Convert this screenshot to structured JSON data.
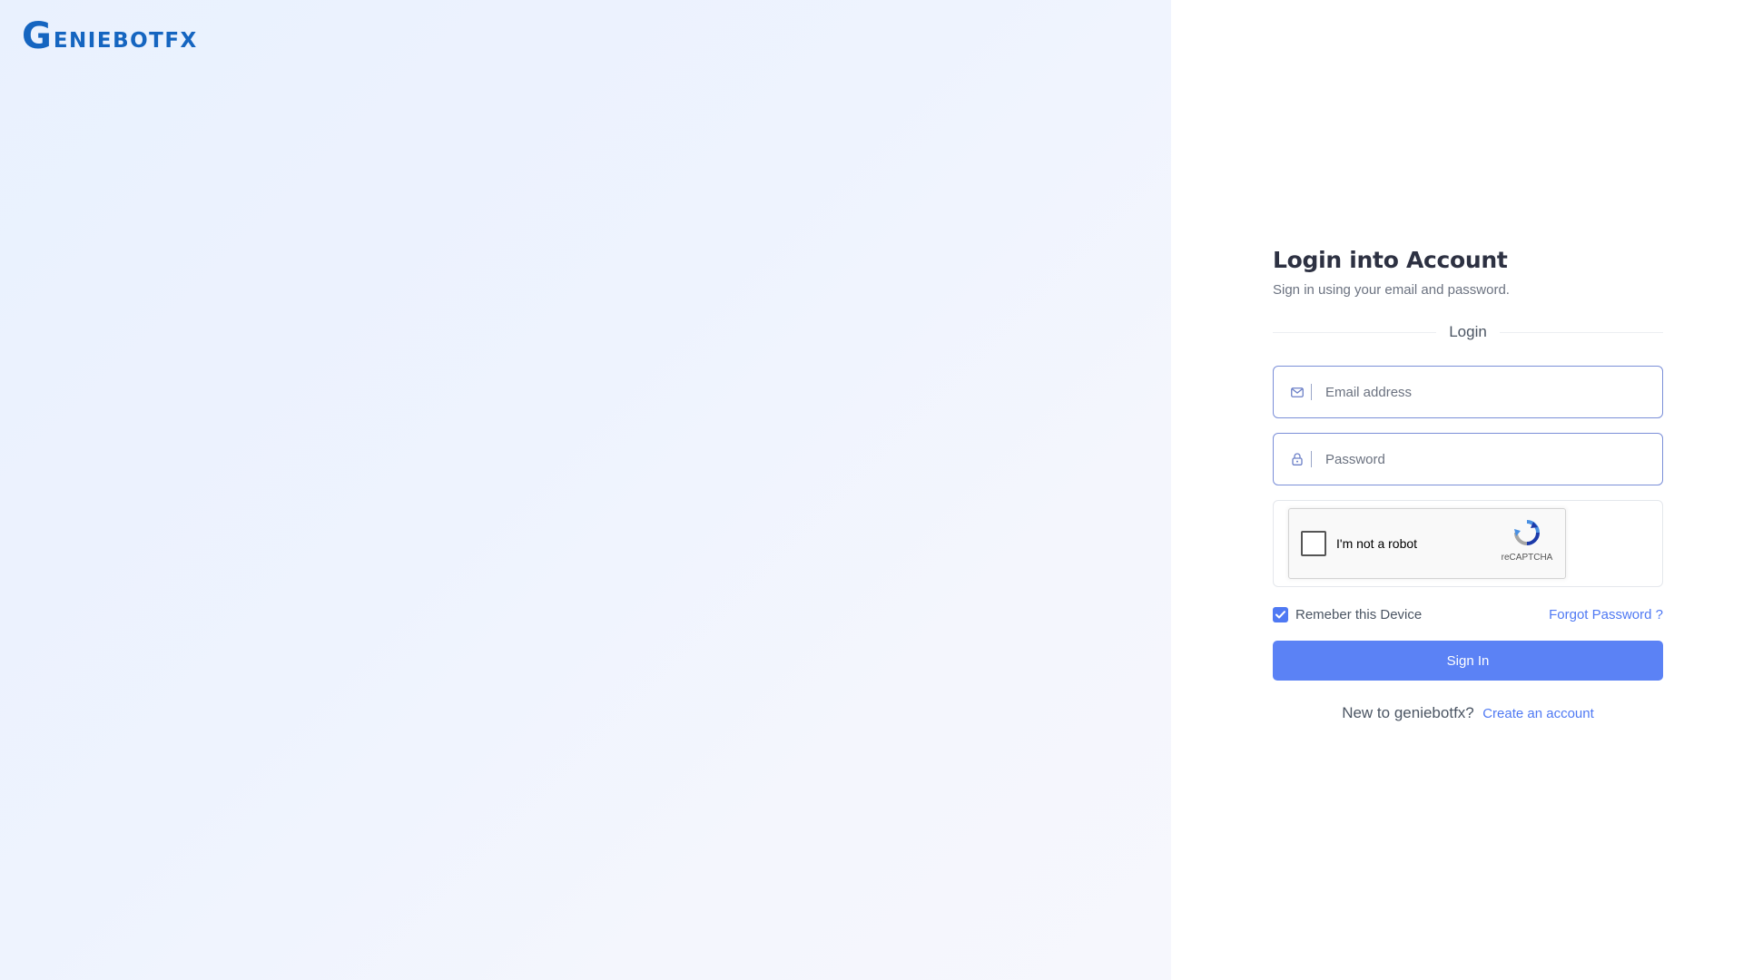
{
  "brand": {
    "logo_first": "G",
    "logo_rest": "ENIEBOTFX",
    "color": "#1565c0"
  },
  "form": {
    "title": "Login into Account",
    "subtitle": "Sign in using your email and password.",
    "divider_label": "Login",
    "email": {
      "placeholder": "Email address",
      "value": "",
      "icon": "mail-icon"
    },
    "password": {
      "placeholder": "Password",
      "value": "",
      "icon": "lock-icon"
    },
    "captcha": {
      "label": "I'm not a robot",
      "brand": "reCAPTCHA",
      "checked": false
    },
    "remember": {
      "label": "Remeber this Device",
      "checked": true
    },
    "forgot_label": "Forgot Password ?",
    "signin_label": "Sign In",
    "signup_prompt": "New to geniebotfx?",
    "signup_link": "Create an account"
  },
  "colors": {
    "accent": "#4f79f3",
    "button": "#5b82f5",
    "input_border": "#7b8fd8",
    "left_panel": "#eaf1fe"
  }
}
